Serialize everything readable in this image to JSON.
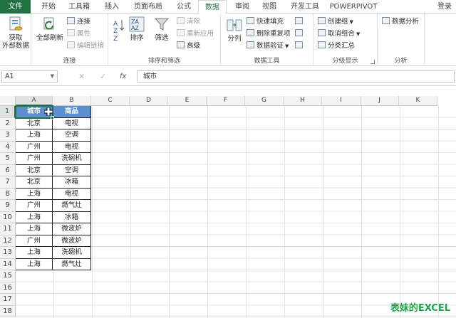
{
  "ribbon_tabs": [
    "文件",
    "开始",
    "工具箱",
    "插入",
    "页面布局",
    "公式",
    "数据",
    "审阅",
    "视图",
    "开发工具",
    "POWERPIVOT"
  ],
  "active_tab": "数据",
  "login": "登录",
  "groups": {
    "connections": {
      "label": "连接",
      "get_external": "获取\n外部数据",
      "refresh_all": "全部刷新",
      "connections": "连接",
      "properties": "属性",
      "edit_links": "编辑链接"
    },
    "sort_filter": {
      "label": "排序和筛选",
      "sort": "排序",
      "filter": "筛选",
      "clear": "清除",
      "reapply": "重新应用",
      "advanced": "高级"
    },
    "data_tools": {
      "label": "数据工具",
      "text_to_columns": "分列",
      "flash_fill": "快速填充",
      "remove_duplicates": "删除重复项",
      "data_validation": "数据验证"
    },
    "outline": {
      "label": "分级显示",
      "group": "创建组",
      "ungroup": "取消组合",
      "subtotal": "分类汇总"
    },
    "analysis": {
      "label": "分析",
      "data_analysis": "数据分析"
    }
  },
  "formula_bar": {
    "name_box": "A1",
    "formula": "城市",
    "cancel_icon": "✕",
    "enter_icon": "✓",
    "fx_label": "fx"
  },
  "columns": [
    "A",
    "B",
    "C",
    "D",
    "E",
    "F",
    "G",
    "H",
    "I",
    "J",
    "K"
  ],
  "rows": [
    "1",
    "2",
    "3",
    "4",
    "5",
    "6",
    "7",
    "8",
    "9",
    "10",
    "11",
    "12",
    "13",
    "14",
    "15",
    "16",
    "17",
    "18"
  ],
  "table": {
    "headers": [
      "城市",
      "商品"
    ],
    "rows": [
      [
        "北京",
        "电视"
      ],
      [
        "上海",
        "空调"
      ],
      [
        "广州",
        "电视"
      ],
      [
        "广州",
        "洗碗机"
      ],
      [
        "北京",
        "空调"
      ],
      [
        "北京",
        "冰箱"
      ],
      [
        "上海",
        "电视"
      ],
      [
        "广州",
        "燃气灶"
      ],
      [
        "上海",
        "冰箱"
      ],
      [
        "上海",
        "微波炉"
      ],
      [
        "广州",
        "微波炉"
      ],
      [
        "上海",
        "洗碗机"
      ],
      [
        "上海",
        "燃气灶"
      ]
    ]
  },
  "watermark": "表妹的EXCEL",
  "colors": {
    "excel_green": "#217346",
    "header_fill": "#5b8fcf",
    "watermark": "#1aa64a"
  }
}
